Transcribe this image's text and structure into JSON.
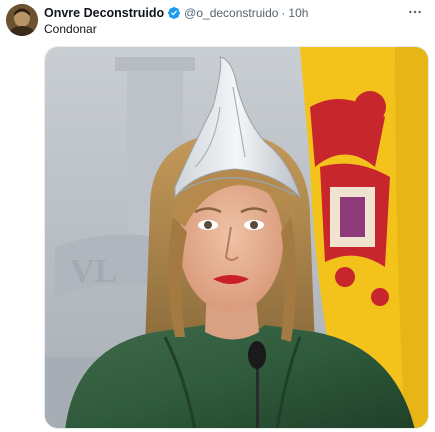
{
  "tweet": {
    "author": {
      "display_name": "Onvre Deconstruido",
      "handle": "@o_deconstruido",
      "verified": true
    },
    "separator": "·",
    "time": "10h",
    "text": "Condonar",
    "icons": {
      "avatar": "profile-photo",
      "verified": "verified-badge-icon",
      "more": "more-options-icon"
    },
    "colors": {
      "verified_badge": "#1d9bf0",
      "name": "#0f1419",
      "secondary_text": "#536471"
    },
    "media": {
      "kind": "photo"
    }
  }
}
